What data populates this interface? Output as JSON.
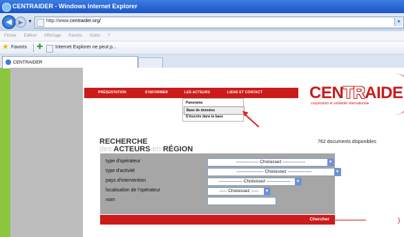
{
  "window": {
    "title": "CENTRAIDER - Windows Internet Explorer"
  },
  "address": {
    "url_prefix": "http://www.",
    "url_host": "centraider.org/"
  },
  "menubar": [
    "Fichier",
    "Edition",
    "Affichage",
    "Favoris",
    "Outils",
    "?"
  ],
  "favorites": {
    "label": "Favoris",
    "link": "Internet Explorer ne peut p..."
  },
  "tab": {
    "label": "CENTRAIDER"
  },
  "nav": {
    "items": [
      "PRÉSENTATION",
      "S'INFORMER",
      "LES ACTEURS",
      "LIENS ET CONTACT"
    ],
    "dropdown": [
      "Panorama",
      "Base de données",
      "S'inscrire dans la base"
    ]
  },
  "logo": {
    "red": "CEN",
    "white": "TR",
    "red2": "AIDER",
    "subtitle": "coopération et solidarité internationale"
  },
  "search": {
    "title_line1": "RECHERCHE",
    "prefix": "des",
    "acteurs": "ACTEURS",
    "en": "en",
    "region": "RÉGION"
  },
  "doc_count": "762 documents disponibles",
  "form": {
    "fields": [
      {
        "label": "type d'opérateur",
        "value": "--------------- Choisissez ---------------"
      },
      {
        "label": "type d'activité",
        "value": "------------------ Choisissez ----------------"
      },
      {
        "label": "pays d'intervention",
        "value": "---------------- Choisissez ----------------"
      },
      {
        "label": "localisation de l'opérateur",
        "value": "----- Choisissez -----"
      },
      {
        "label": "nom",
        "value": ""
      }
    ],
    "submit": "Chercher"
  },
  "colors": {
    "brand_red": "#cc1b1b",
    "background_green": "#8cc63f"
  }
}
